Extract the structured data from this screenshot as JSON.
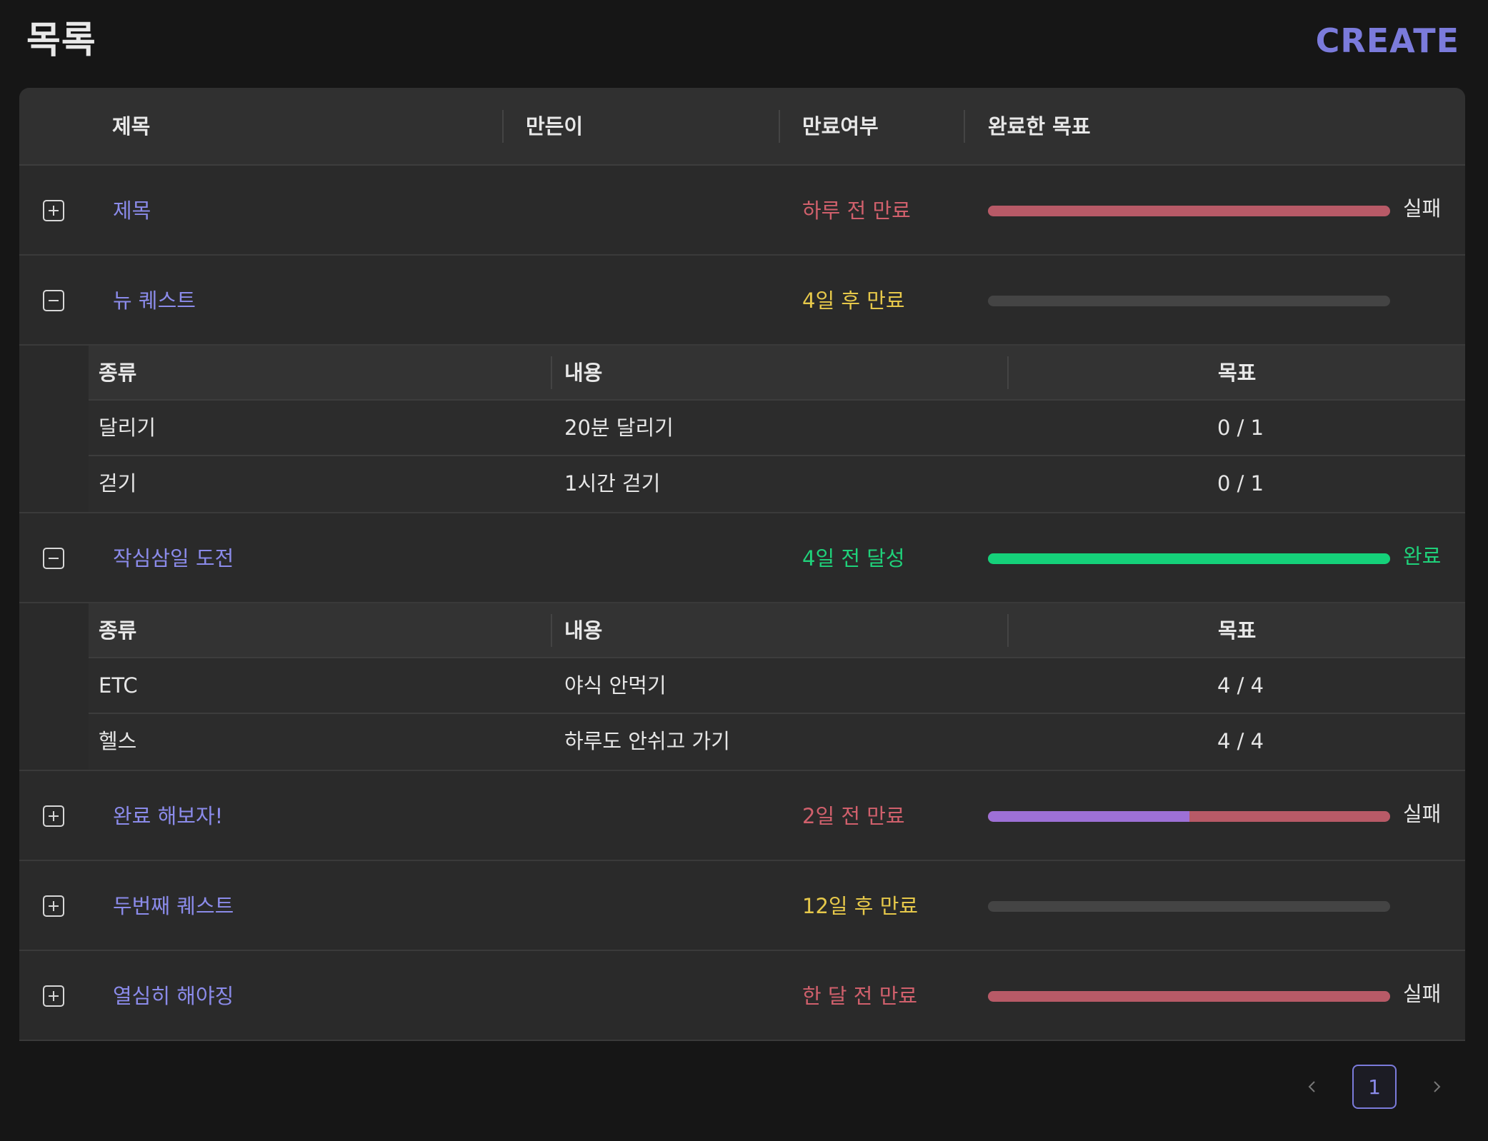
{
  "header": {
    "title": "목록",
    "create_label": "CREATE"
  },
  "table": {
    "columns": [
      "제목",
      "만든이",
      "만료여부",
      "완료한 목표"
    ]
  },
  "sub_columns": [
    "종류",
    "내용",
    "목표"
  ],
  "rows": [
    {
      "title": "제목",
      "status": "하루 전 만료",
      "status_type": "expired",
      "progress_label": "실패",
      "progress_fraction": 0
    },
    {
      "title": "뉴 퀘스트",
      "status": "4일 후 만료",
      "status_type": "pending",
      "progress_label": "",
      "progress_fraction": 0,
      "goals": [
        {
          "type": "달리기",
          "content": "20분 달리기",
          "target": "0 / 1"
        },
        {
          "type": "걷기",
          "content": "1시간 걷기",
          "target": "0 / 1"
        }
      ]
    },
    {
      "title": "작심삼일 도전",
      "status": "4일 전 달성",
      "status_type": "done",
      "progress_label": "완료",
      "progress_fraction": 1,
      "goals": [
        {
          "type": "ETC",
          "content": "야식 안먹기",
          "target": "4 / 4"
        },
        {
          "type": "헬스",
          "content": "하루도 안쉬고 가기",
          "target": "4 / 4"
        }
      ]
    },
    {
      "title": "완료 해보자!",
      "status": "2일 전 만료",
      "status_type": "expired",
      "progress_label": "실패",
      "progress_fraction": 0.5
    },
    {
      "title": "두번째 퀘스트",
      "status": "12일 후 만료",
      "status_type": "pending",
      "progress_label": "",
      "progress_fraction": 0
    },
    {
      "title": "열심히 해야징",
      "status": "한 달 전 만료",
      "status_type": "expired",
      "progress_label": "실패",
      "progress_fraction": 0
    }
  ],
  "pagination": {
    "current_page": "1"
  },
  "colors": {
    "accent": "#7b7bdb",
    "expired": "#d0606c",
    "pending": "#e6c84a",
    "done": "#1fd17a",
    "fail_bar": "#b85a67",
    "partial_bar": "#9d70d6"
  },
  "icons": {
    "expand": "plus-square-icon",
    "collapse": "minus-square-icon",
    "prev": "chevron-left-icon",
    "next": "chevron-right-icon"
  }
}
